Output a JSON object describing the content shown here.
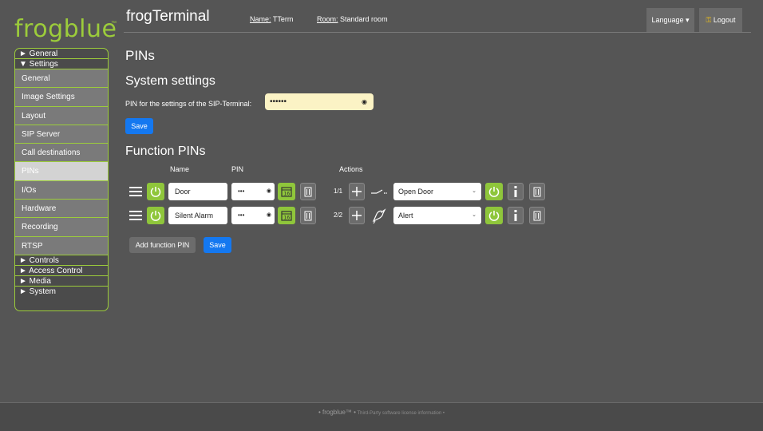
{
  "brand": {
    "name": "frogblue",
    "tm": "™"
  },
  "header": {
    "app_title": "frogTerminal",
    "name_label": "Name:",
    "name_value": "TTerm",
    "room_label": "Room:",
    "room_value": "Standard room",
    "language_label": "Language ▾",
    "logout_label": "Logout"
  },
  "sidebar": {
    "general": "► General",
    "settings": "▼ Settings",
    "items": [
      "General",
      "Image Settings",
      "Layout",
      "SIP Server",
      "Call destinations",
      "PINs",
      "I/Os",
      "Hardware",
      "Recording",
      "RTSP"
    ],
    "active_item": "PINs",
    "controls": "► Controls",
    "access_control": "► Access Control",
    "media": "► Media",
    "system": "► System"
  },
  "main": {
    "page_title": "PINs",
    "system_heading": "System settings",
    "pin_label": "PIN for the settings of the SIP-Terminal:",
    "pin_value": "••••••",
    "save_label": "Save",
    "function_heading": "Function PINs",
    "col_name": "Name",
    "col_pin": "PIN",
    "col_actions": "Actions",
    "rows": [
      {
        "name": "Door",
        "pin": "•••",
        "count": "1/1",
        "action": "Open Door",
        "action_icon": "switch-icon"
      },
      {
        "name": "Silent Alarm",
        "pin": "•••",
        "count": "2/2",
        "action": "Alert",
        "action_icon": "bird-alert-icon"
      }
    ],
    "add_label": "Add function PIN",
    "save2_label": "Save"
  },
  "footer": {
    "brand": "• frogblue™ •",
    "license": "Third-Party software license information •"
  },
  "colors": {
    "accent": "#9ccc3b",
    "button_blue": "#1478f0",
    "background": "#555555"
  }
}
